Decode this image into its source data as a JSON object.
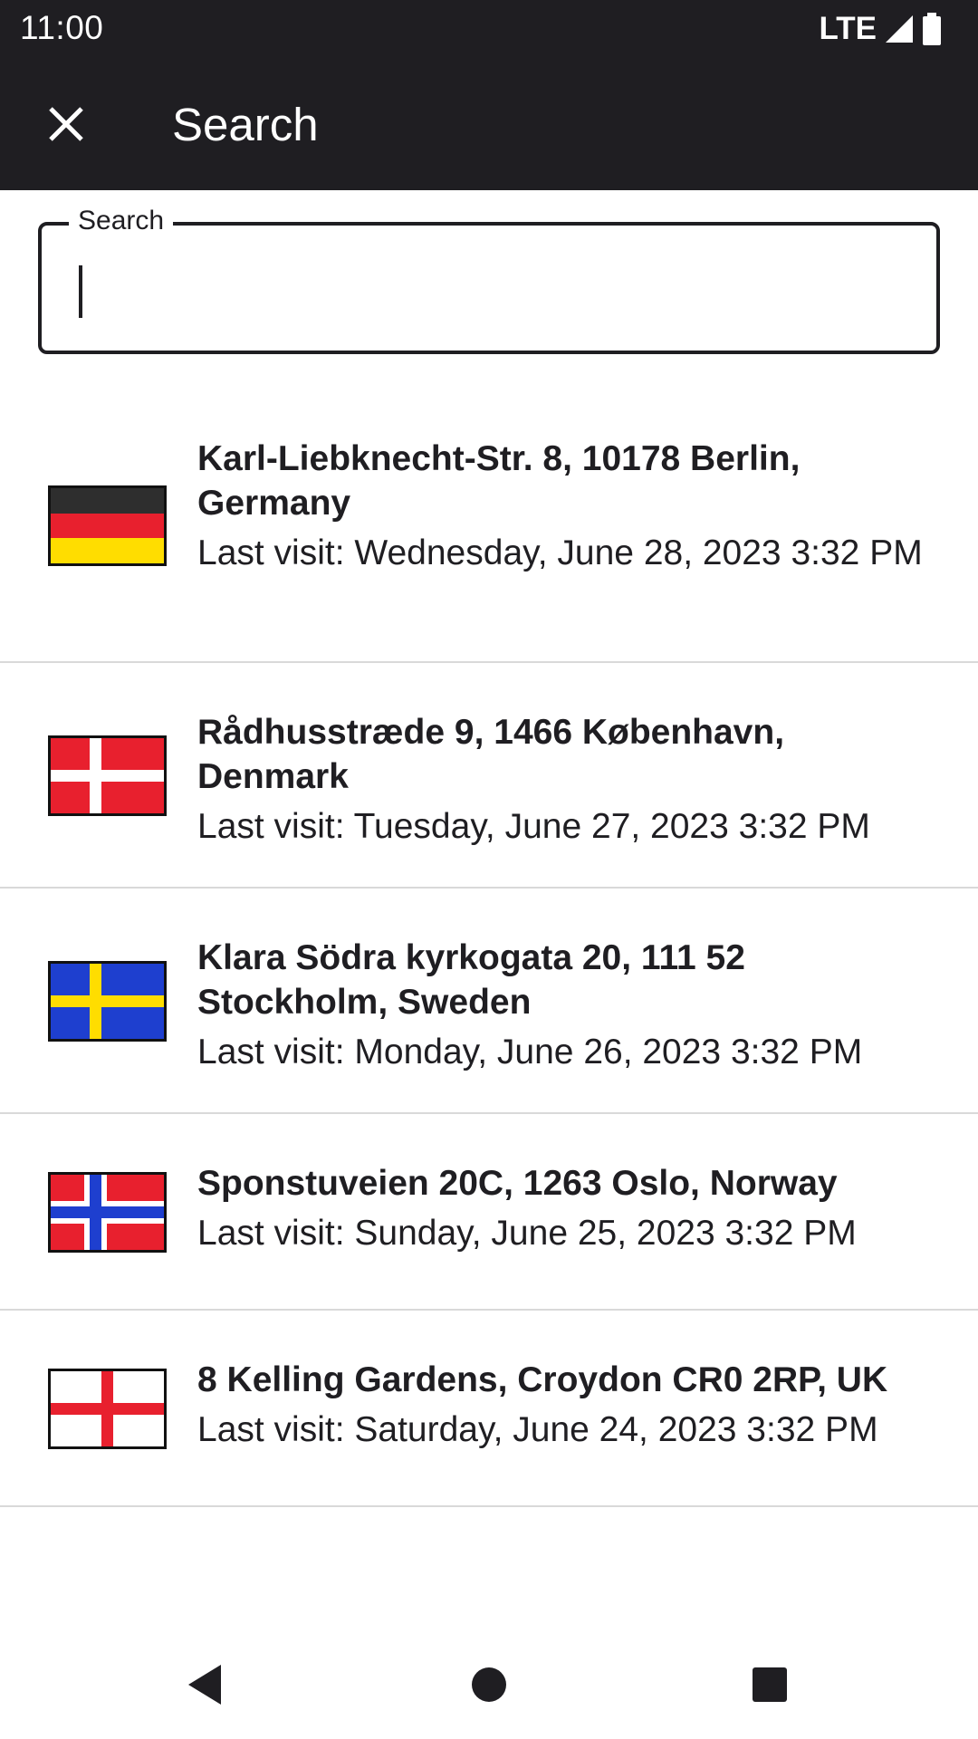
{
  "status": {
    "time": "11:00",
    "network": "LTE",
    "icons": [
      "signal-icon",
      "battery-icon"
    ]
  },
  "appbar": {
    "close_icon": "close-icon",
    "title": "Search"
  },
  "search": {
    "label": "Search",
    "value": "",
    "placeholder": ""
  },
  "results": [
    {
      "flag": "germany-flag-icon",
      "address": "Karl-Liebknecht-Str. 8, 10178 Berlin, Germany",
      "visit": "Last visit: Wednesday, June 28, 2023 3:32 PM"
    },
    {
      "flag": "denmark-flag-icon",
      "address": "Rådhusstræde 9, 1466 København, Denmark",
      "visit": "Last visit: Tuesday, June 27, 2023 3:32 PM"
    },
    {
      "flag": "sweden-flag-icon",
      "address": "Klara Södra kyrkogata 20, 111 52 Stockholm, Sweden",
      "visit": "Last visit: Monday, June 26, 2023 3:32 PM"
    },
    {
      "flag": "norway-flag-icon",
      "address": "Sponstuveien 20C, 1263 Oslo, Norway",
      "visit": "Last visit: Sunday, June 25, 2023 3:32 PM"
    },
    {
      "flag": "england-flag-icon",
      "address": "8 Kelling Gardens, Croydon CR0 2RP, UK",
      "visit": "Last visit: Saturday, June 24, 2023 3:32 PM"
    }
  ],
  "navbar": {
    "back": "back-icon",
    "home": "home-icon",
    "recents": "recents-icon"
  },
  "colors": {
    "bar": "#1f1e22",
    "divider": "#d9d9d9"
  }
}
